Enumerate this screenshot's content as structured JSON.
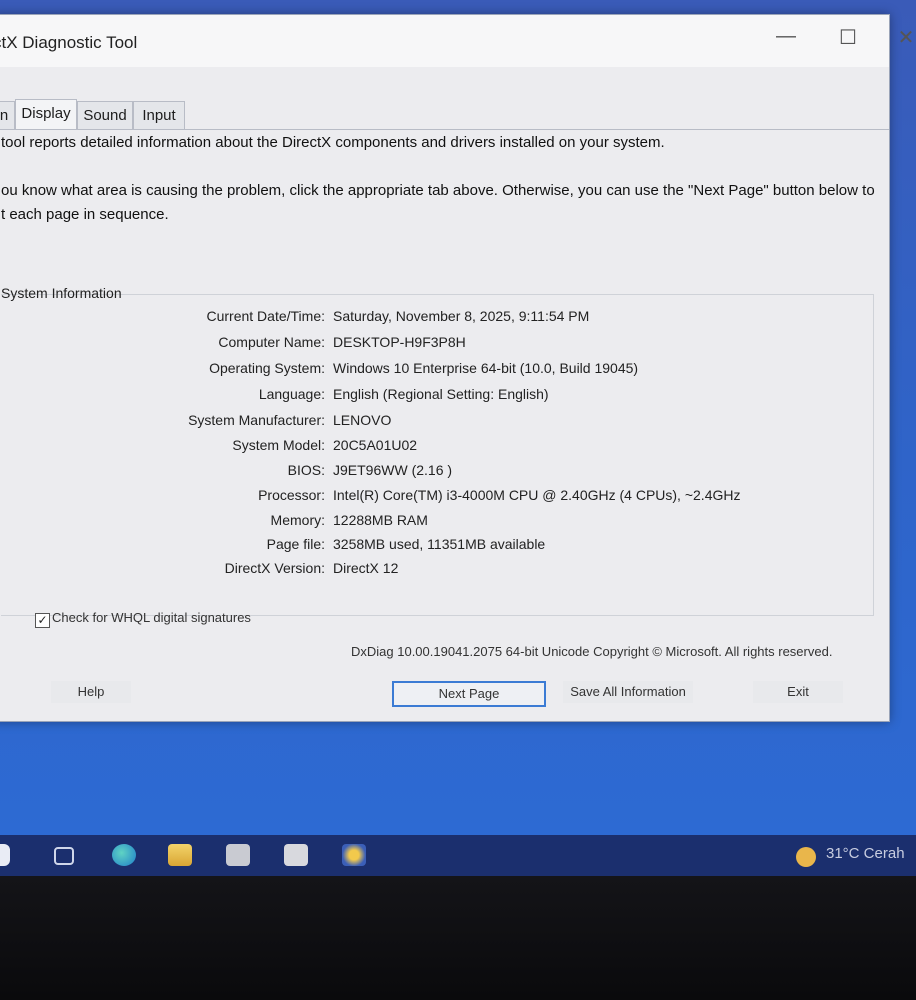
{
  "window": {
    "title": "ctX Diagnostic Tool",
    "minimize_glyph": "—",
    "maximize_glyph": "☐",
    "close_glyph": "✕"
  },
  "tabs": [
    {
      "label": "n"
    },
    {
      "label": "Display"
    },
    {
      "label": "Sound"
    },
    {
      "label": "Input"
    }
  ],
  "intro": {
    "line1": "tool reports detailed information about the DirectX components and drivers installed on your system.",
    "line2": "ou know what area is causing the problem, click the appropriate tab above.  Otherwise, you can use the \"Next Page\" button below to",
    "line3": "t each page in sequence."
  },
  "system_info": {
    "heading": "System Information",
    "rows": [
      {
        "label": "Current Date/Time:",
        "value": "Saturday, November 8, 2025, 9:11:54 PM"
      },
      {
        "label": "Computer Name:",
        "value": "DESKTOP-H9F3P8H"
      },
      {
        "label": "Operating System:",
        "value": "Windows 10 Enterprise 64-bit (10.0, Build 19045)"
      },
      {
        "label": "Language:",
        "value": "English (Regional Setting: English)"
      },
      {
        "label": "System Manufacturer:",
        "value": "LENOVO"
      },
      {
        "label": "System Model:",
        "value": "20C5A01U02"
      },
      {
        "label": "BIOS:",
        "value": "J9ET96WW (2.16 )"
      },
      {
        "label": "Processor:",
        "value": "Intel(R) Core(TM) i3-4000M CPU @ 2.40GHz (4 CPUs), ~2.4GHz"
      },
      {
        "label": "Memory:",
        "value": "12288MB RAM"
      },
      {
        "label": "Page file:",
        "value": "3258MB used, 11351MB available"
      },
      {
        "label": "DirectX Version:",
        "value": "DirectX 12"
      }
    ]
  },
  "whql": {
    "label": "Check for WHQL digital signatures",
    "checked": true,
    "check_glyph": "✓"
  },
  "copyright": "DxDiag 10.00.19041.2075 64-bit Unicode  Copyright © Microsoft. All rights reserved.",
  "buttons": {
    "help": "Help",
    "next_page": "Next Page",
    "save_all": "Save All Information",
    "exit": "Exit"
  },
  "taskbar": {
    "icons": [
      "task-view-icon",
      "edge-icon",
      "file-explorer-icon",
      "app-icon",
      "app-icon-2",
      "dxdiag-icon"
    ],
    "weather": "31°C  Cerah"
  },
  "colors": {
    "desktop": "#2f64c9",
    "taskbar": "#1b2f6e",
    "primary_button_border": "#3b7bd4"
  }
}
